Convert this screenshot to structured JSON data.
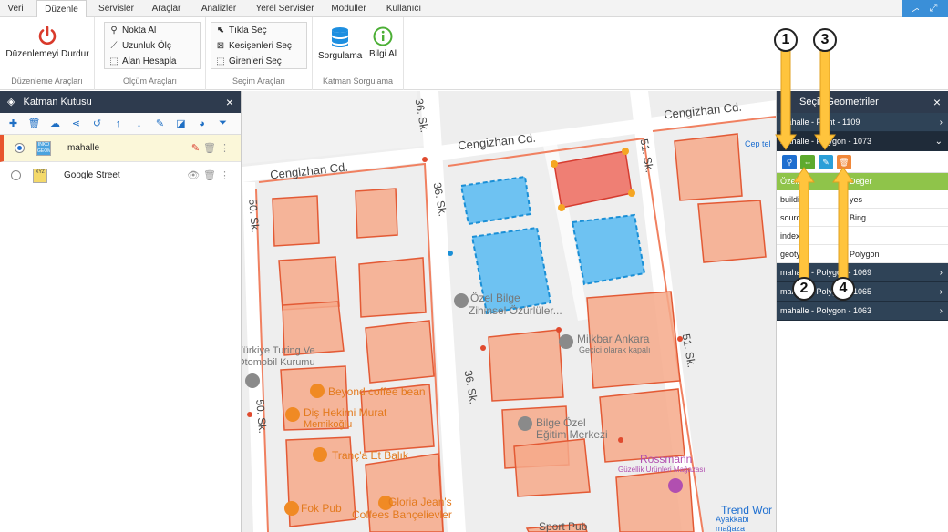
{
  "menu": {
    "tabs": [
      "Veri",
      "Düzenle",
      "Servisler",
      "Araçlar",
      "Analizler",
      "Yerel Servisler",
      "Modüller",
      "Kullanıcı"
    ],
    "active_tab": "Düzenle"
  },
  "ribbon": {
    "stop_edit": "Düzenlemeyi Durdur",
    "edit_tools_label": "Düzenleme Araçları",
    "measure": [
      "Nokta Al",
      "Uzunluk Ölç",
      "Alan Hesapla"
    ],
    "measure_label": "Ölçüm Araçları",
    "select": [
      "Tıkla Seç",
      "Kesişenleri Seç",
      "Girenleri Seç"
    ],
    "select_label": "Seçim Araçları",
    "query": "Sorgulama",
    "info": "Bilgi Al",
    "query_label": "Katman Sorgulama"
  },
  "layer_panel": {
    "title": "Katman Kutusu",
    "layers": [
      {
        "name": "mahalle",
        "thumb": "INKO GEOM"
      },
      {
        "name": "Google Street",
        "thumb": "XYZ"
      }
    ]
  },
  "map": {
    "streets": [
      "Cengizhan Cd.",
      "Cengizhan Cd.",
      "Cengizhan Cd.",
      "36. Sk.",
      "36. Sk.",
      "36. Sk.",
      "50. Sk.",
      "50. Sk.",
      "51. Sk.",
      "51. Sk."
    ],
    "places": [
      "Özel Bilge",
      "Zihinsel Özürlüler...",
      "Milkbar Ankara",
      "Geçici olarak kapalı",
      "Türkiye Turing Ve",
      "Otomobil Kurumu",
      "Beyond coffee bean",
      "Diş Hekimi Murat",
      "Memikoğlu",
      "Tranç'a Et Balık",
      "Bilge Özel",
      "Eğitim Merkezi",
      "Rossmann",
      "Güzellik Ürünleri Mağazası",
      "Fok Pub",
      "Gloria Jean's",
      "Coffees Bahçelievler",
      "Sport Pub",
      "Cep tel",
      "Trend Wor",
      "Ayakkabı mağaza"
    ]
  },
  "right_panel": {
    "title": "Seçili Geometriler",
    "rows_top": [
      "mahalle - Point - 1109",
      "mahalle - Polygon - 1073"
    ],
    "table_header": [
      "Özellik",
      "Değer"
    ],
    "table_rows": [
      [
        "building",
        "yes"
      ],
      [
        "source",
        "Bing"
      ],
      [
        "index",
        ""
      ],
      [
        "geotype",
        "Polygon"
      ]
    ],
    "rows_bottom": [
      "mahalle - Polygon - 1069",
      "mahalle - Polygon - 1065",
      "mahalle - Polygon - 1063"
    ]
  },
  "callouts": [
    "1",
    "2",
    "3",
    "4"
  ],
  "colors": {
    "accent": "#1e6fd0",
    "header": "#2e3b4e",
    "table_header": "#8fc44a",
    "arrow": "#ffc43d",
    "parcel": "#f6a98a",
    "selected": "#6ec2f2",
    "highlight": "#ef7f74"
  }
}
